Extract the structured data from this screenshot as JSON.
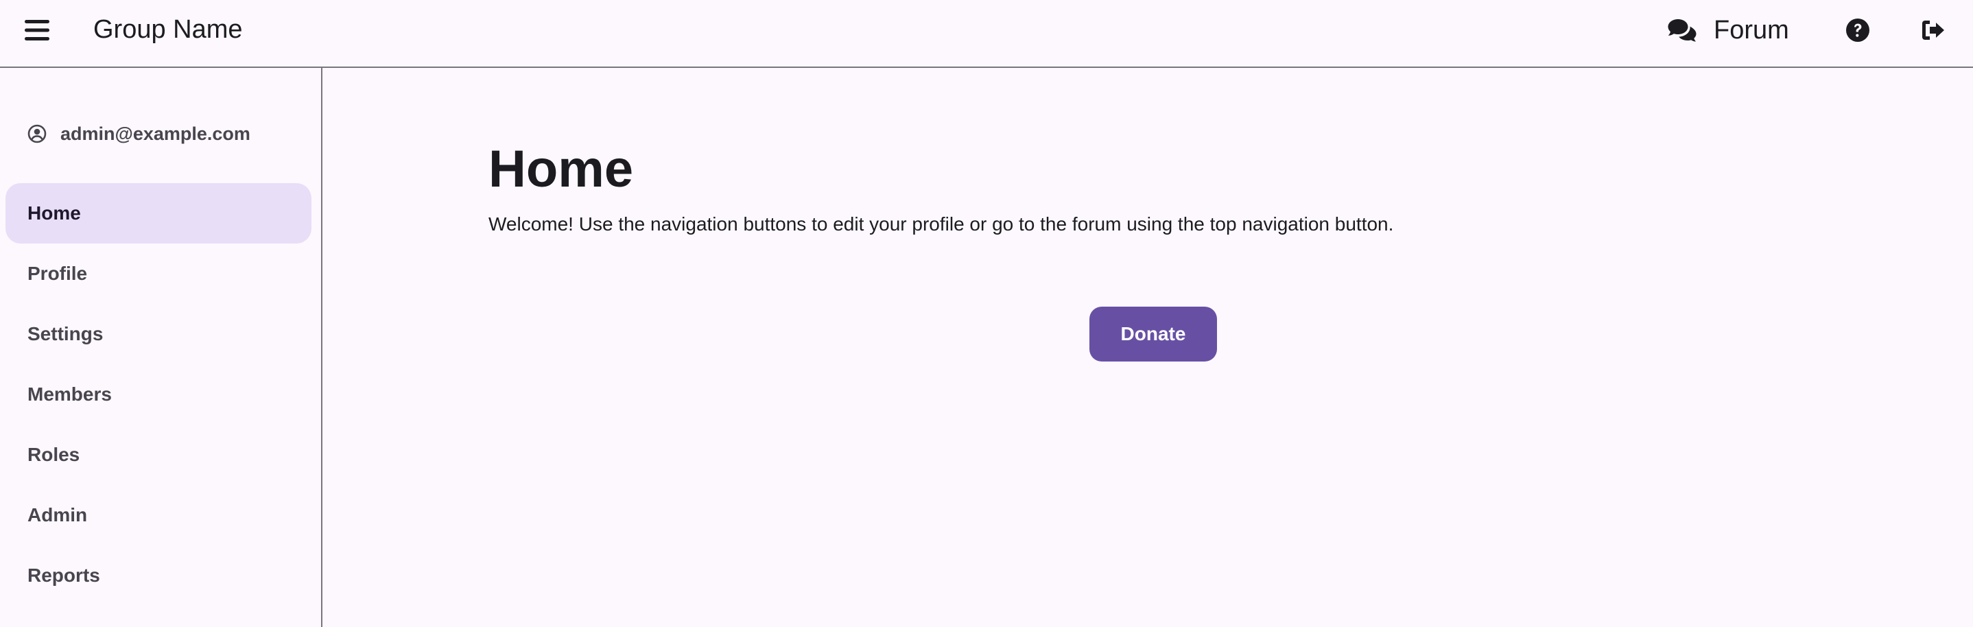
{
  "header": {
    "title": "Group Name",
    "menu_icon": "hamburger-menu-icon",
    "forum_label": "Forum",
    "forum_icon": "comments-icon",
    "help_icon": "question-circle-icon",
    "logout_icon": "sign-out-icon"
  },
  "sidebar": {
    "user_email": "admin@example.com",
    "user_icon": "user-circle-icon",
    "items": [
      {
        "label": "Home",
        "active": true
      },
      {
        "label": "Profile",
        "active": false
      },
      {
        "label": "Settings",
        "active": false
      },
      {
        "label": "Members",
        "active": false
      },
      {
        "label": "Roles",
        "active": false
      },
      {
        "label": "Admin",
        "active": false
      },
      {
        "label": "Reports",
        "active": false
      }
    ]
  },
  "main": {
    "title": "Home",
    "welcome": "Welcome! Use the navigation buttons to edit your profile or go to the forum using the top navigation button.",
    "donate_label": "Donate"
  },
  "colors": {
    "background": "#fcf8fd",
    "primary": "#6750a4",
    "active_nav": "#e8def8",
    "divider": "#79747e",
    "text": "#1c1b1f"
  }
}
